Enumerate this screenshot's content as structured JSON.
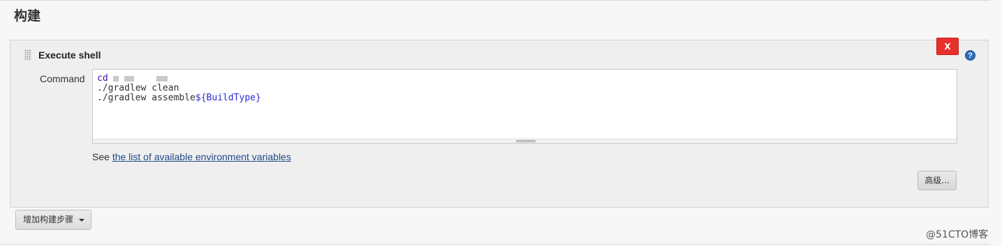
{
  "section": {
    "title": "构建"
  },
  "builder": {
    "title": "Execute shell",
    "delete_label": "X",
    "help_label": "?",
    "command_label": "Command",
    "command_lines": {
      "line1_kw": "cd",
      "line2": "./gradlew clean",
      "line3_prefix": "./gradlew assemble",
      "line3_var": "${BuildType}"
    },
    "env_prefix": "See ",
    "env_link": "the list of available environment variables",
    "advanced_label": "高级..."
  },
  "add_step": {
    "label": "增加构建步骤"
  },
  "watermark": "@51CTO博客",
  "icons": {
    "drag": "drag-handle-icon",
    "help": "help-icon",
    "dropdown": "chevron-down-icon"
  },
  "colors": {
    "delete_button": "#e8302a",
    "help_icon": "#2d6fb8",
    "link": "#204a87",
    "keyword": "#4b0aa5",
    "variable": "#2a2ad6"
  }
}
